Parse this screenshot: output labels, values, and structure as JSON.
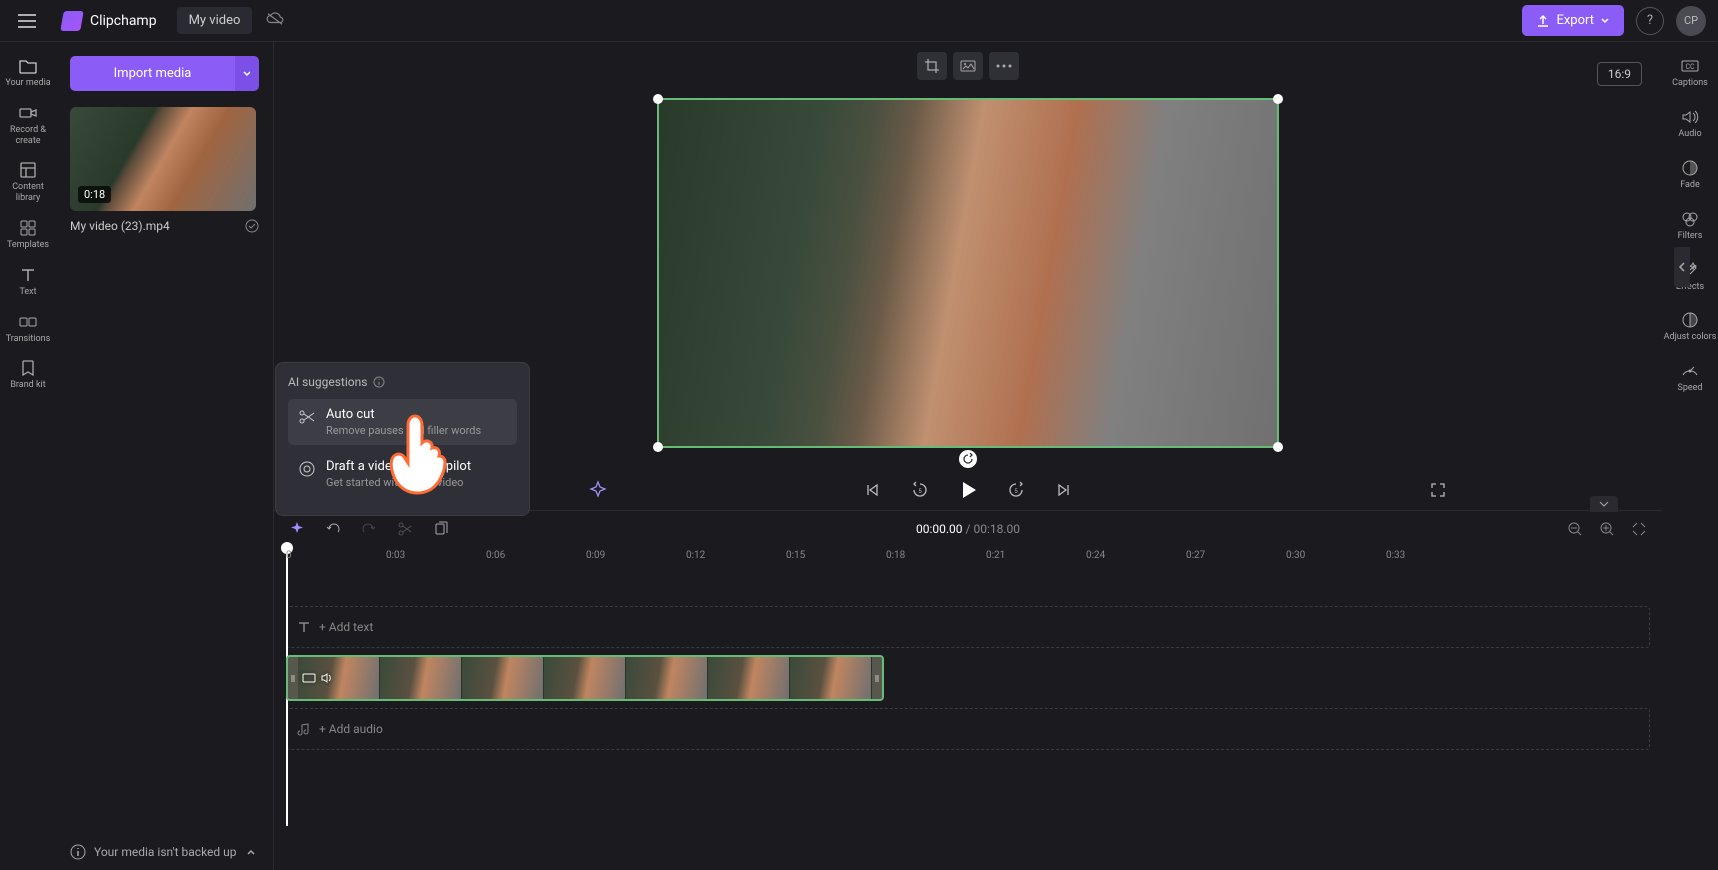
{
  "app": {
    "name": "Clipchamp",
    "project_name": "My video"
  },
  "topbar": {
    "export_label": "Export",
    "avatar_initials": "CP"
  },
  "left_nav": [
    {
      "label": "Your media"
    },
    {
      "label": "Record & create"
    },
    {
      "label": "Content library"
    },
    {
      "label": "Templates"
    },
    {
      "label": "Text"
    },
    {
      "label": "Transitions"
    },
    {
      "label": "Brand kit"
    }
  ],
  "media_panel": {
    "import_label": "Import media",
    "thumb_duration": "0:18",
    "filename": "My video (23).mp4"
  },
  "ai_popup": {
    "title": "AI suggestions",
    "items": [
      {
        "title": "Auto cut",
        "desc": "Remove pauses and filler words"
      },
      {
        "title": "Draft a video with Copilot",
        "desc": "Get started with a first video"
      }
    ]
  },
  "right_sidebar": [
    {
      "label": "Captions"
    },
    {
      "label": "Audio"
    },
    {
      "label": "Fade"
    },
    {
      "label": "Filters"
    },
    {
      "label": "Effects"
    },
    {
      "label": "Adjust colors"
    },
    {
      "label": "Speed"
    }
  ],
  "preview": {
    "aspect_ratio": "16:9"
  },
  "timeline": {
    "current_time": "00:00.00",
    "total_time": "00:18.00",
    "ticks": [
      "0",
      "0:03",
      "0:06",
      "0:09",
      "0:12",
      "0:15",
      "0:18",
      "0:21",
      "0:24",
      "0:27",
      "0:30",
      "0:33"
    ],
    "add_text_label": "+ Add text",
    "add_audio_label": "+ Add audio"
  },
  "footer": {
    "backup_notice": "Your media isn't backed up"
  }
}
